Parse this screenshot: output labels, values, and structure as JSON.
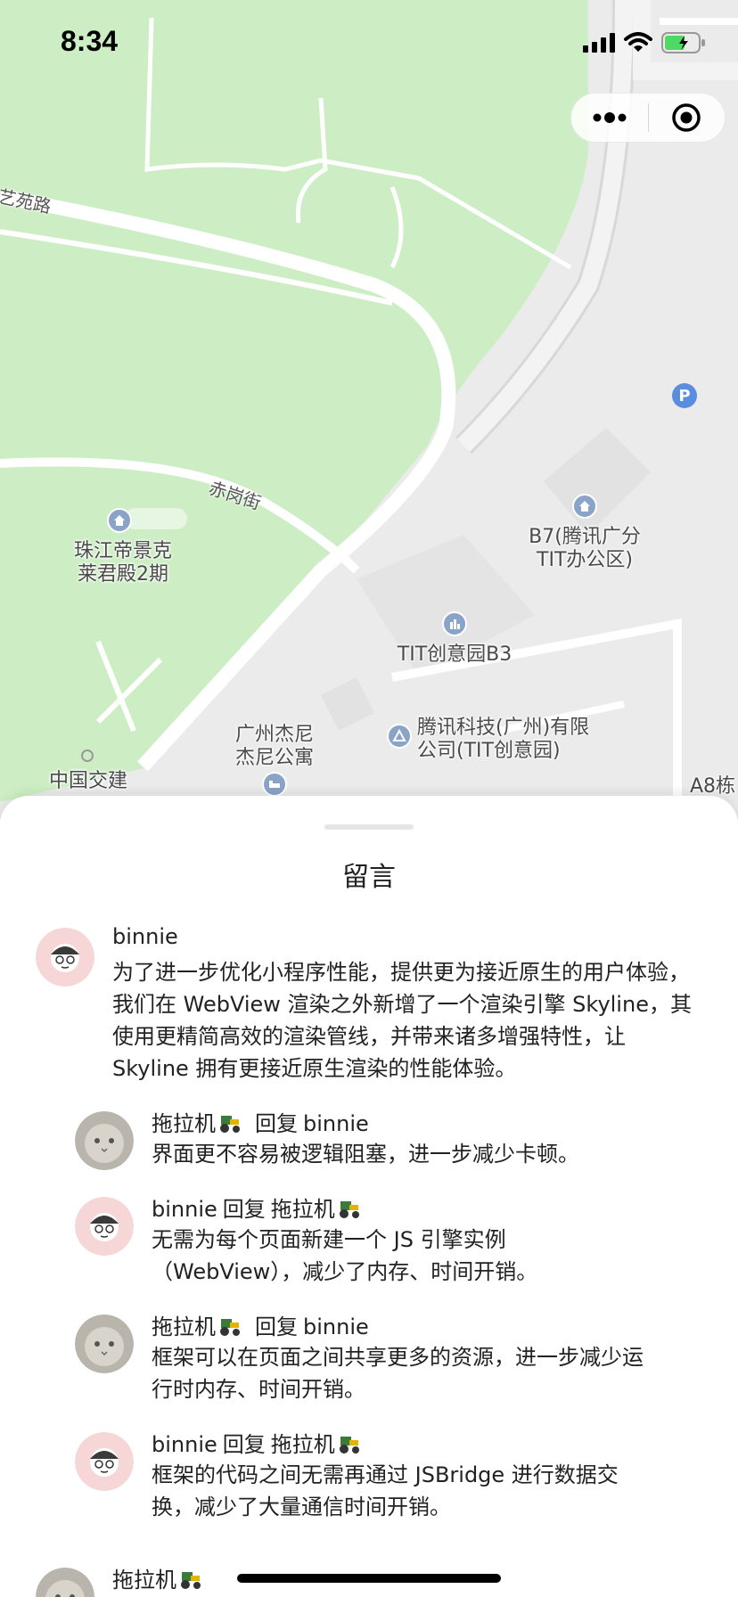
{
  "status_bar": {
    "time": "8:34"
  },
  "capsule": {
    "more_icon": "ellipsis-icon",
    "close_icon": "target-icon"
  },
  "map": {
    "labels": {
      "road_yiyuan": "艺苑路",
      "road_chigang": "赤岗街",
      "poi_zhujiang": "珠江帝景克\n莱君殿2期",
      "poi_b7": "B7(腾讯广分\nTIT办公区)",
      "poi_b3": "TIT创意园B3",
      "poi_tencent": "腾讯科技(广州)有限\n公司(TIT创意园)",
      "poi_jieni": "广州杰尼\n杰尼公寓",
      "poi_zhongguo": "中国交建",
      "poi_a8": "A8栋",
      "parking": "P"
    }
  },
  "sheet": {
    "title": "留言",
    "reply_word": "回复",
    "comments": [
      {
        "author": "binnie",
        "text": "为了进一步优化小程序性能，提供更为接近原生的用户体验，我们在 WebView 渲染之外新增了一个渲染引擎 Skyline，其使用更精简高效的渲染管线，并带来诸多增强特性，让 Skyline 拥有更接近原生渲染的性能体验。"
      },
      {
        "author": "拖拉机",
        "reply_to": "binnie",
        "text": "界面更不容易被逻辑阻塞，进一步减少卡顿。"
      },
      {
        "author": "binnie",
        "reply_to": "拖拉机",
        "text": "无需为每个页面新建一个 JS 引擎实例（WebView），减少了内存、时间开销。"
      },
      {
        "author": "拖拉机",
        "reply_to": "binnie",
        "text": "框架可以在页面之间共享更多的资源，进一步减少运行时内存、时间开销。"
      },
      {
        "author": "binnie",
        "reply_to": "拖拉机",
        "text": "框架的代码之间无需再通过 JSBridge 进行数据交换，减少了大量通信时间开销。"
      },
      {
        "author": "拖拉机"
      }
    ]
  },
  "colors": {
    "map_green": "#cdeec4",
    "map_gray": "#ebebeb",
    "road": "#ffffff",
    "poi_blue": "#8aa4c8",
    "parking_blue": "#5a8de0"
  }
}
